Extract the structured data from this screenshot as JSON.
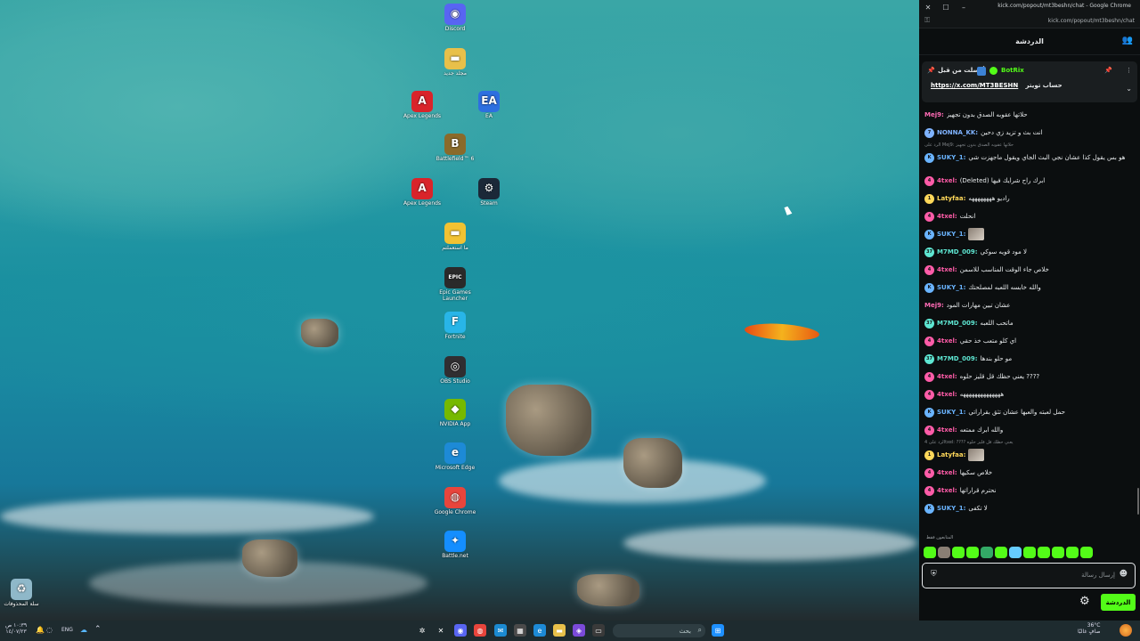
{
  "desktop": {
    "icons": [
      {
        "label": "Discord",
        "icon": "discord-icon",
        "color": "#5865f2",
        "glyph": "◉"
      },
      {
        "label": "مجلد جديد",
        "icon": "folder-icon",
        "color": "#e8c04a",
        "glyph": "▬"
      },
      {
        "label": "Apex Legends",
        "icon": "apex-icon",
        "color": "#d9242a",
        "glyph": "A"
      },
      {
        "label": "EA",
        "icon": "ea-icon",
        "color": "#2d6fe0",
        "glyph": "EA"
      },
      {
        "label": "Battlefield™ 6",
        "icon": "battlefield-icon",
        "color": "#8a6a2a",
        "glyph": "B"
      },
      {
        "label": "Apex Legends",
        "icon": "apex-icon",
        "color": "#d9242a",
        "glyph": "A"
      },
      {
        "label": "Steam",
        "icon": "steam-icon",
        "color": "#1b2838",
        "glyph": "⚙"
      },
      {
        "label": "ما استعملتم",
        "icon": "folder-icon",
        "color": "#f1c232",
        "glyph": "▬"
      },
      {
        "label": "Epic Games Launcher",
        "icon": "epic-icon",
        "color": "#2a2a2a",
        "glyph": "EPIC"
      },
      {
        "label": "Fortnite",
        "icon": "fortnite-icon",
        "color": "#28b5e8",
        "glyph": "F"
      },
      {
        "label": "OBS Studio",
        "icon": "obs-icon",
        "color": "#302e31",
        "glyph": "◎"
      },
      {
        "label": "NVIDIA App",
        "icon": "nvidia-icon",
        "color": "#76b900",
        "glyph": "◆"
      },
      {
        "label": "Microsoft Edge",
        "icon": "edge-icon",
        "color": "#1d8ad6",
        "glyph": "e"
      },
      {
        "label": "Google Chrome",
        "icon": "chrome-icon",
        "color": "#e8453c",
        "glyph": "◍"
      },
      {
        "label": "Battle.net",
        "icon": "battlenet-icon",
        "color": "#148eff",
        "glyph": "✦"
      }
    ],
    "recycle_bin_label": "سلة المحذوفات"
  },
  "taskbar": {
    "clock_time": "١٠:٣٩ ص",
    "clock_date": "١٤/٠٧/٢٣",
    "language": "ENG",
    "search_placeholder": "بحث",
    "weather_temp": "36°C",
    "weather_desc": "صافٍ غالبًا"
  },
  "window": {
    "title": "kick.com/popout/mt3beshn/chat - Google Chrome",
    "url": "kick.com/popout/mt3beshn/chat",
    "close_glyph": "✕",
    "maximize_glyph": "☐",
    "minimize_glyph": "–"
  },
  "chat": {
    "header_title": "الدردشة",
    "pinned": {
      "sender": "BotRix",
      "label": "أرسلت من قبل",
      "link": "https://x.com/MT3BESHN",
      "text": "حساب تويتر"
    },
    "messages": [
      {
        "user": "Mej9:",
        "color": "#ff6bb5",
        "badge": "",
        "text": "حلاتها عقوبه الصدق بدون تجهيز"
      },
      {
        "user": "NONNA_KK:",
        "color": "#7fb3ff",
        "badge": "7",
        "text": "انت بث و تزيد زي دحين"
      },
      {
        "user": "SUKY_1:",
        "color": "#6ab4ff",
        "badge": "K",
        "text": "هو بس يقول كذا عشان نجي البث الجاي ويقول ماجهزت شي",
        "reply": "الرد على Mej9: حلاتها عقوبه الصدق بدون تجهيز"
      },
      {
        "user": "4txel:",
        "color": "#ff5ca8",
        "badge": "4",
        "text": "(Deleted) ابرك راح شرايك فيها"
      },
      {
        "user": "Latyfaa:",
        "color": "#ffd85a",
        "badge": "1",
        "text": "راديو ههههههههه"
      },
      {
        "user": "4txel:",
        "color": "#ff5ca8",
        "badge": "4",
        "text": "انحلت"
      },
      {
        "user": "SUKY_1:",
        "color": "#6ab4ff",
        "badge": "K",
        "text": ""
      },
      {
        "user": "M7MD_009:",
        "color": "#5ee6d2",
        "badge": "37",
        "text": "لا مود قويه سوكي"
      },
      {
        "user": "4txel:",
        "color": "#ff5ca8",
        "badge": "4",
        "text": "خلاص جاء الوقت المناسب للاسمن"
      },
      {
        "user": "SUKY_1:",
        "color": "#6ab4ff",
        "badge": "K",
        "text": "والله خابسه اللعبه لمصلحتك"
      },
      {
        "user": "Mej9:",
        "color": "#ff6bb5",
        "badge": "",
        "text": "عشان تبين مهارات المود"
      },
      {
        "user": "M7MD_009:",
        "color": "#5ee6d2",
        "badge": "37",
        "text": "ماتحب اللعبه"
      },
      {
        "user": "4txel:",
        "color": "#ff5ca8",
        "badge": "4",
        "text": "اي كلو متعب خذ حقي"
      },
      {
        "user": "M7MD_009:",
        "color": "#5ee6d2",
        "badge": "37",
        "text": "مو حلو بندها"
      },
      {
        "user": "4txel:",
        "color": "#ff5ca8",
        "badge": "4",
        "text": "???? يعني حظك قل قليز حلوه"
      },
      {
        "user": "4txel:",
        "color": "#ff5ca8",
        "badge": "4",
        "text": "ههههههههههههههه"
      },
      {
        "user": "SUKY_1:",
        "color": "#6ab4ff",
        "badge": "K",
        "text": "حمل لعبته والعبها عشان تثق بقراراتي"
      },
      {
        "user": "4txel:",
        "color": "#ff5ca8",
        "badge": "4",
        "text": "والله ابرك ممتعه"
      },
      {
        "user": "Latyfaa:",
        "color": "#ffd85a",
        "badge": "1",
        "text": "",
        "reply": "الرد على 4txel: ???? يعني حظك قل قليز حلوه"
      },
      {
        "user": "4txel:",
        "color": "#ff5ca8",
        "badge": "4",
        "text": "خلاص سكيها"
      },
      {
        "user": "4txel:",
        "color": "#ff5ca8",
        "badge": "4",
        "text": "نحترم قراراتها"
      },
      {
        "user": "SUKY_1:",
        "color": "#6ab4ff",
        "badge": "K",
        "text": "لا تكفى"
      }
    ],
    "emote_label": "المتابعون فقط",
    "input_placeholder": "إرسال رسالة",
    "send_label": "الدردشة"
  }
}
